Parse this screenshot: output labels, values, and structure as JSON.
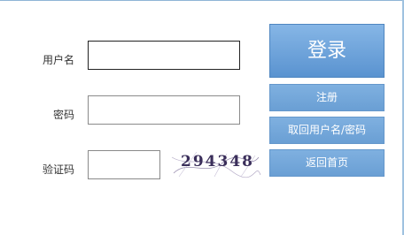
{
  "form": {
    "username_label": "用户名",
    "password_label": "密码",
    "captcha_label": "验证码",
    "username_value": "",
    "password_value": "",
    "captcha_value": "",
    "captcha_code": "294348"
  },
  "buttons": {
    "login": "登录",
    "register": "注册",
    "recover": "取回用户名/密码",
    "home": "返回首页"
  }
}
